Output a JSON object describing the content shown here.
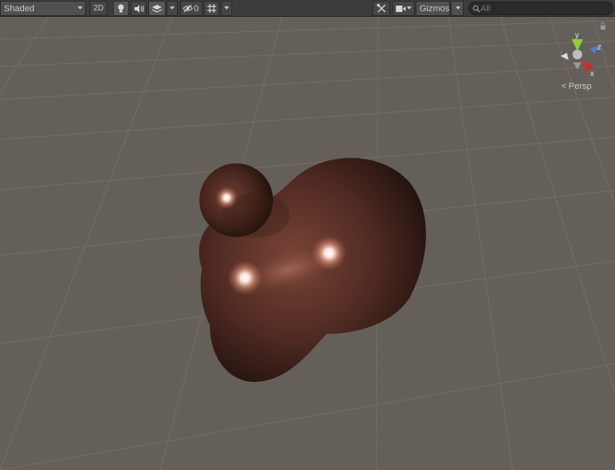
{
  "toolbar": {
    "shading_mode": "Shaded",
    "mode_2d_label": "2D",
    "hidden_count": "0",
    "gizmos_label": "Gizmos",
    "search_placeholder": "All"
  },
  "gizmo": {
    "axis_y": "y",
    "axis_z": "z",
    "axis_x": "x",
    "projection_label": "Persp"
  },
  "colors": {
    "scene_background": "#655f5a",
    "grid_lines": "#7a7470",
    "metaball": "#5a3028",
    "axis_y": "#8fcf3a",
    "axis_z": "#4a7fd8",
    "axis_x": "#c8322a"
  },
  "icons": [
    "light-bulb-icon",
    "speaker-icon",
    "effects-layers-icon",
    "hidden-eye-icon",
    "grid-icon",
    "tools-icon",
    "camera-icon",
    "search-icon",
    "lock-icon"
  ]
}
